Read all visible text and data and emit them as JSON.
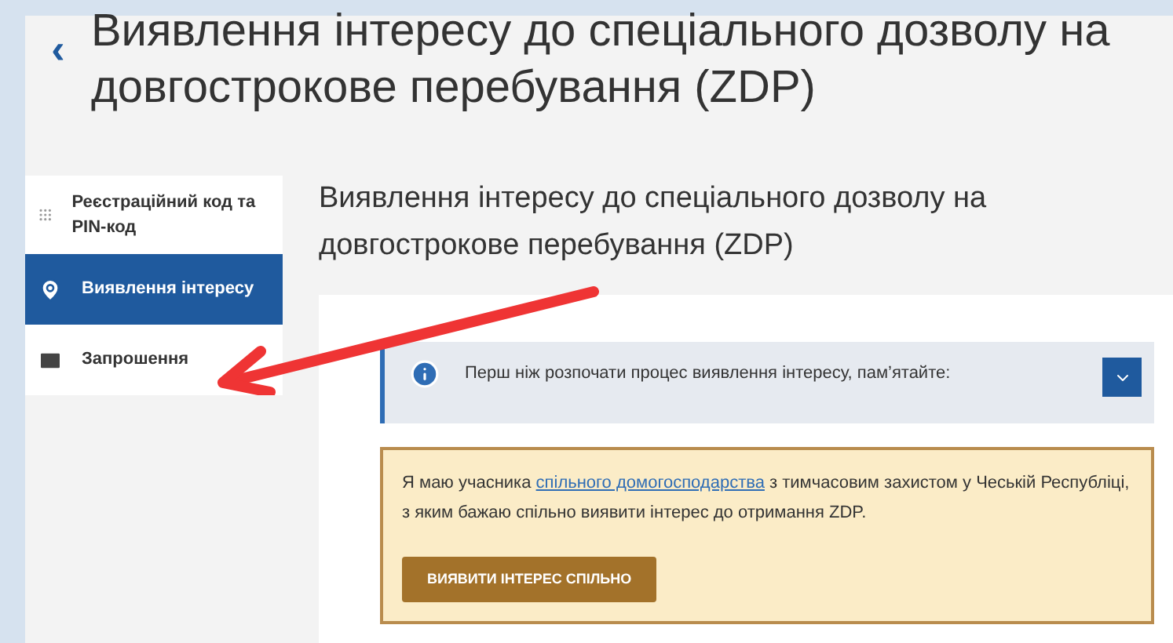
{
  "header": {
    "back": "‹",
    "title": "Виявлення інтересу до спеціального дозволу на довгострокове перебування (ZDP)"
  },
  "sidebar": {
    "items": [
      {
        "kind": "grid",
        "label": "Реєстраційний код та PIN-код",
        "selected": false
      },
      {
        "kind": "pin",
        "label": "Виявлення інтересу",
        "selected": true
      },
      {
        "kind": "mail",
        "label": "Запрошення",
        "selected": false
      }
    ]
  },
  "main": {
    "heading": "Виявлення інтересу до спеціального дозволу на довгострокове перебування (ZDP)",
    "notice": {
      "text": "Перш ніж розпочати процес виявлення інтересу, пам’ятайте:",
      "expanded": false
    },
    "joint": {
      "text_before": "Я маю учасника ",
      "link": "спільного домогосподарства",
      "text_after": " з тимчасовим захистом у Чеській Республіці, з яким бажаю спільно виявити інтерес до отримання ZDP.",
      "button": "ВИЯВИТИ ІНТЕРЕС СПІЛЬНО"
    }
  }
}
